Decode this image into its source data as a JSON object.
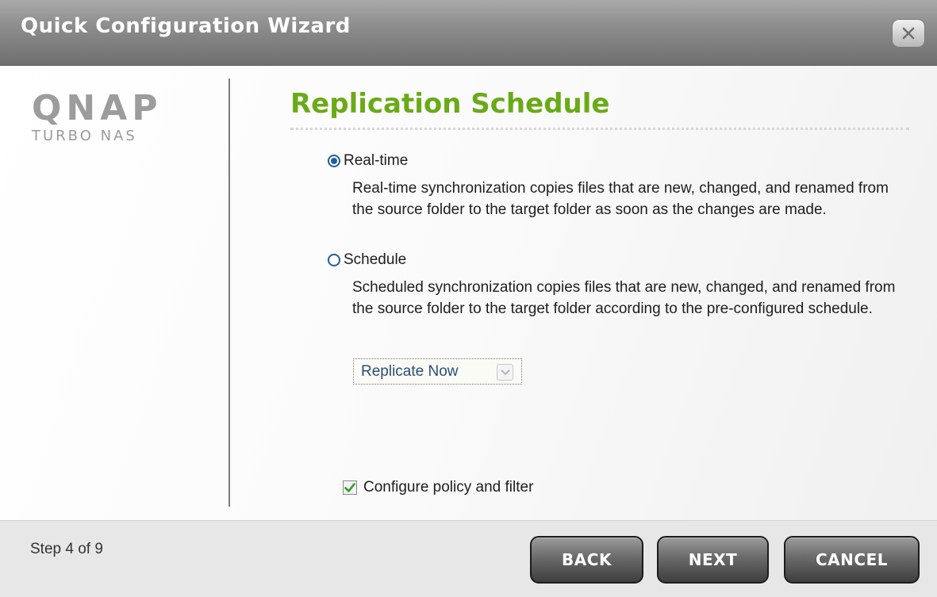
{
  "window": {
    "title": "Quick Configuration Wizard"
  },
  "logo": {
    "brand": "QNAP",
    "subtitle": "TURBO NAS"
  },
  "page": {
    "heading": "Replication Schedule"
  },
  "options": {
    "realtime": {
      "label": "Real-time",
      "selected": true,
      "description": "Real-time synchronization copies files that are new, changed, and renamed from the source folder to the target folder as soon as the changes are made."
    },
    "schedule": {
      "label": "Schedule",
      "selected": false,
      "description": "Scheduled synchronization copies files that are new, changed, and renamed from the source folder to the target folder according to the pre-configured schedule."
    }
  },
  "schedule_select": {
    "value": "Replicate Now"
  },
  "policy_checkbox": {
    "label": "Configure policy and filter",
    "checked": true
  },
  "footer": {
    "step": "Step 4 of 9",
    "back_label": "BACK",
    "next_label": "NEXT",
    "cancel_label": "CANCEL"
  },
  "colors": {
    "heading": "#6aaa18",
    "titlebar": "#8a8a8a",
    "radio": "#1f5f9a",
    "check": "#2e9b1e"
  }
}
